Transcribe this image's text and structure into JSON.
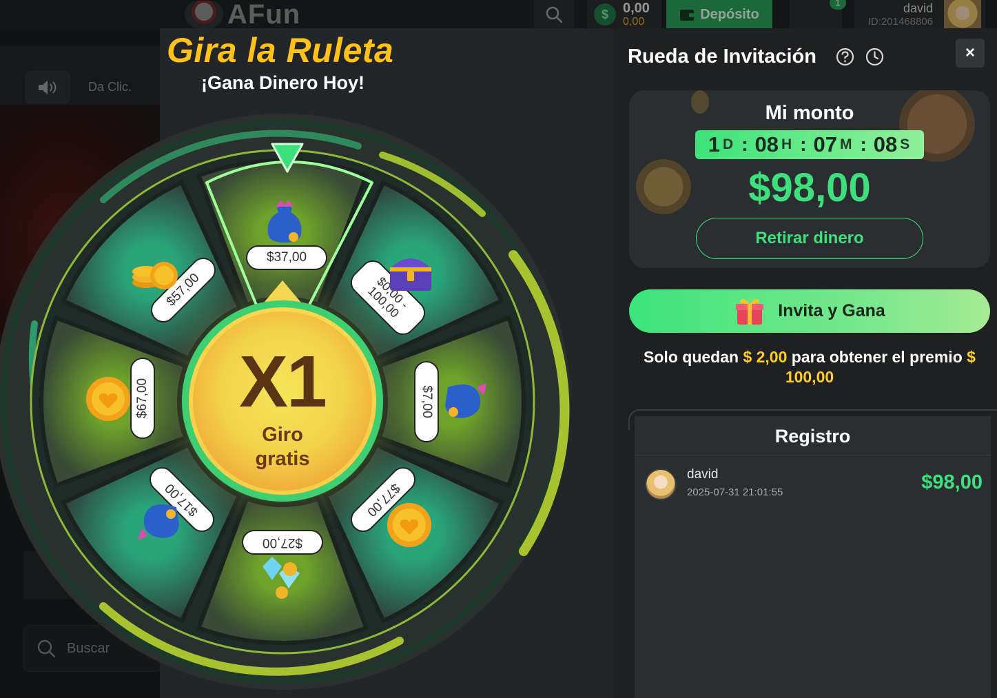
{
  "site": {
    "logo_text": "AFun",
    "balance_main": "0,00",
    "balance_sub": "0,00",
    "deposit_label": "Depósito",
    "gift_badge": "1",
    "user_name": "david",
    "user_id": "ID:201468806",
    "sound_hint": "Da Clic.",
    "search_placeholder": "Buscar"
  },
  "wheel": {
    "title": "Gira la Ruleta",
    "subtitle": "¡Gana Dinero Hoy!",
    "multiplier": "X1",
    "free_spin_label": "Giro gratis",
    "prizes": [
      {
        "label": "$37,00",
        "icon": "money-bag-icon"
      },
      {
        "label": "$0,00 - 100,00",
        "icon": "treasure-chest-icon"
      },
      {
        "label": "$7,00",
        "icon": "money-bag-icon"
      },
      {
        "label": "$77,00",
        "icon": "gold-coin-icon"
      },
      {
        "label": "$27,00",
        "icon": "diamonds-coins-icon"
      },
      {
        "label": "$17,00",
        "icon": "money-bag-icon"
      },
      {
        "label": "$67,00",
        "icon": "gold-coin-icon"
      },
      {
        "label": "$57,00",
        "icon": "coin-stack-icon"
      }
    ],
    "colors": {
      "accent_green": "#3ecf72",
      "title_yellow": "#ffc21a"
    }
  },
  "panel": {
    "title": "Rueda de Invitación",
    "close_label": "×",
    "card": {
      "title": "Mi monto",
      "timer": {
        "d": "1",
        "d_unit": "D",
        "h": "08",
        "h_unit": "H",
        "m": "07",
        "m_unit": "M",
        "s": "08",
        "s_unit": "S"
      },
      "amount": "$98,00",
      "withdraw_label": "Retirar dinero"
    },
    "invite_label": "Invita y Gana",
    "remaining": {
      "prefix": "Solo quedan",
      "currency1": "$",
      "amount": "2,00",
      "middle": "para obtener el premio",
      "currency2": "$",
      "prize": "100,00"
    },
    "registro": {
      "title": "Registro",
      "rows": [
        {
          "name": "david",
          "time": "2025-07-31 21:01:55",
          "amount": "$98,00"
        }
      ]
    }
  }
}
